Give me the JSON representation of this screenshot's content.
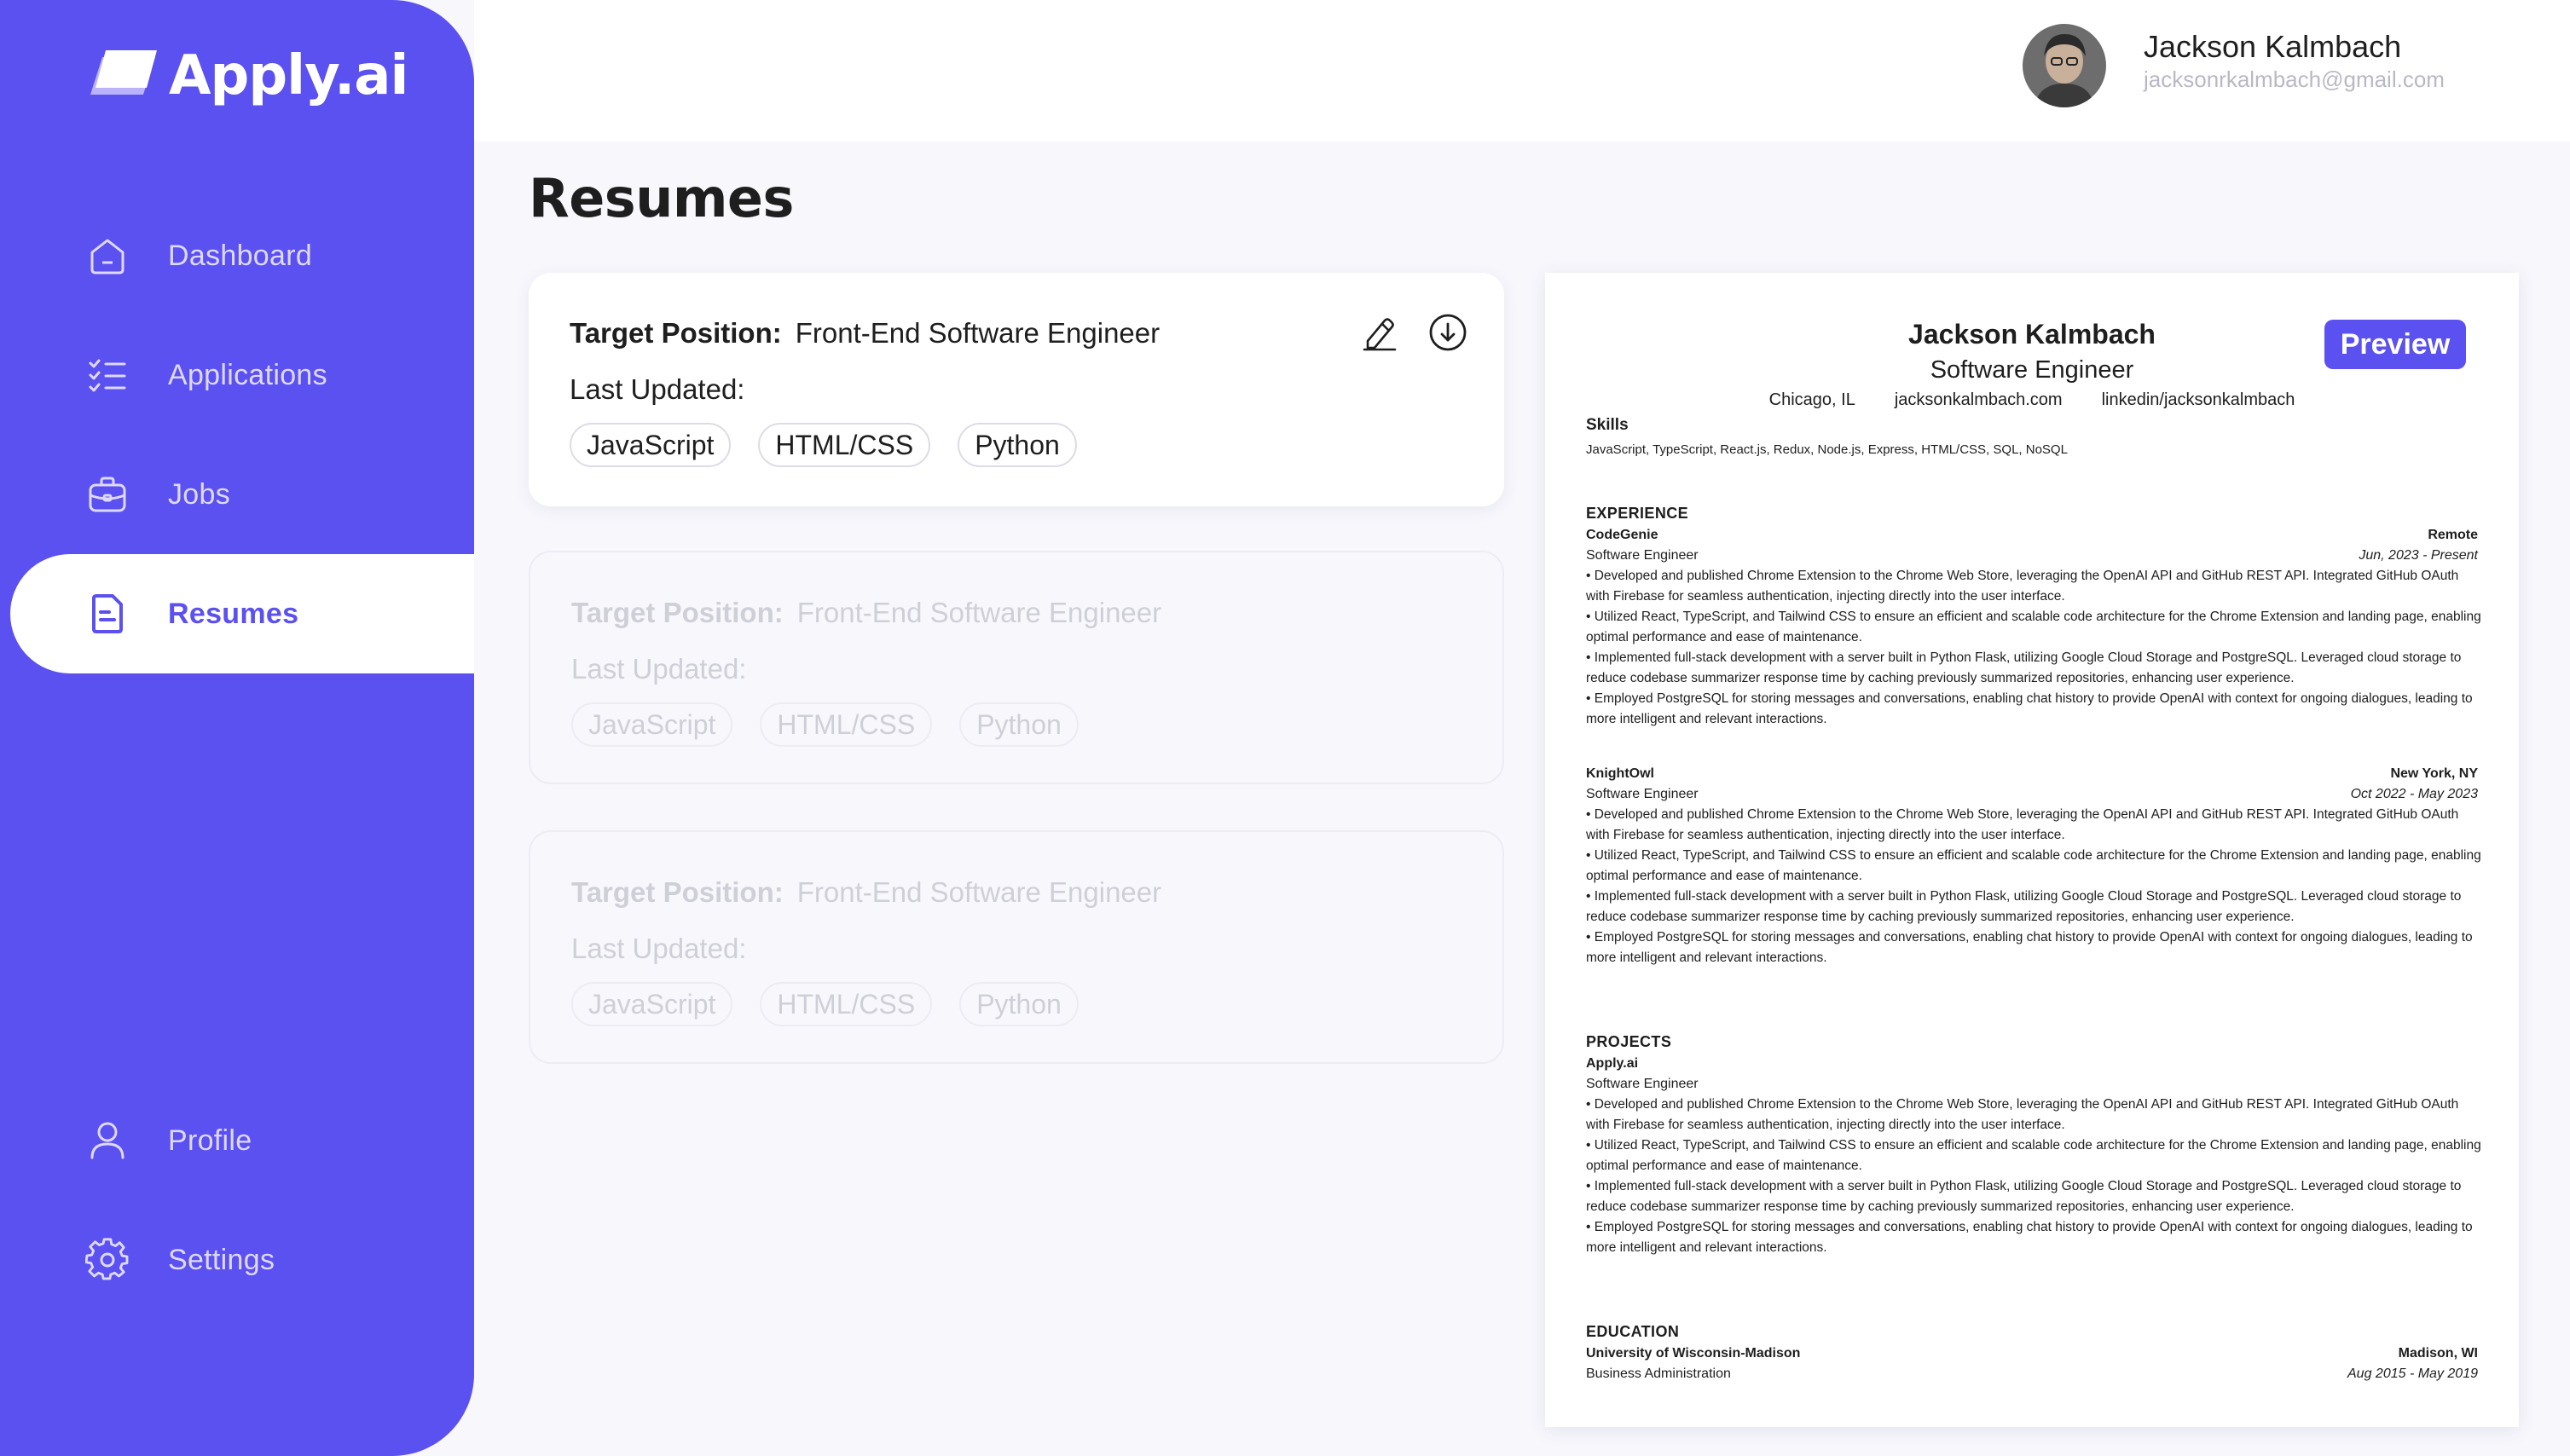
{
  "app": {
    "name": "Apply.ai"
  },
  "sidebar": {
    "items": [
      {
        "label": "Dashboard",
        "icon": "home-icon"
      },
      {
        "label": "Applications",
        "icon": "checklist-icon"
      },
      {
        "label": "Jobs",
        "icon": "briefcase-icon"
      },
      {
        "label": "Resumes",
        "icon": "document-icon",
        "active": true
      },
      {
        "label": "Profile",
        "icon": "user-icon"
      },
      {
        "label": "Settings",
        "icon": "gear-icon"
      }
    ]
  },
  "header": {
    "user_name": "Jackson Kalmbach",
    "user_email": "jacksonrkalmbach@gmail.com"
  },
  "main": {
    "title": "Resumes",
    "cards": [
      {
        "target_label": "Target Position:",
        "target_value": "Front-End Software Engineer",
        "updated_label": "Last Updated:",
        "tags": [
          "JavaScript",
          "HTML/CSS",
          "Python"
        ]
      },
      {
        "target_label": "Target Position:",
        "target_value": "Front-End Software Engineer",
        "updated_label": "Last Updated:",
        "tags": [
          "JavaScript",
          "HTML/CSS",
          "Python"
        ]
      },
      {
        "target_label": "Target Position:",
        "target_value": "Front-End Software Engineer",
        "updated_label": "Last Updated:",
        "tags": [
          "JavaScript",
          "HTML/CSS",
          "Python"
        ]
      }
    ]
  },
  "preview": {
    "button_label": "Preview",
    "name": "Jackson Kalmbach",
    "role": "Software Engineer",
    "contacts": [
      "Chicago, IL",
      "jacksonkalmbach.com",
      "linkedin/jacksonkalmbach"
    ],
    "skills_title": "Skills",
    "skills": "JavaScript, TypeScript, React.js, Redux, Node.js, Express, HTML/CSS, SQL, NoSQL",
    "experience_title": "EXPERIENCE",
    "experience": [
      {
        "company": "CodeGenie",
        "location": "Remote",
        "title": "Software Engineer",
        "dates": "Jun, 2023 - Present",
        "bullets": [
          "• Developed and published Chrome Extension to the Chrome Web Store, leveraging the OpenAI API and GitHub REST API. Integrated GitHub OAuth with Firebase for seamless authentication, injecting directly into the user interface.",
          "• Utilized React, TypeScript, and Tailwind CSS to ensure an efficient and scalable code architecture for the Chrome Extension and landing page, enabling optimal performance and ease of maintenance.",
          "• Implemented full-stack development with a server built in Python Flask, utilizing Google Cloud Storage and PostgreSQL. Leveraged cloud storage to reduce codebase summarizer response time by caching previously summarized repositories, enhancing user experience.",
          "• Employed PostgreSQL for storing messages and conversations, enabling chat history to provide OpenAI with context for ongoing dialogues, leading to more intelligent and relevant interactions."
        ]
      },
      {
        "company": "KnightOwl",
        "location": "New York, NY",
        "title": "Software Engineer",
        "dates": "Oct 2022 - May 2023",
        "bullets": [
          "• Developed and published Chrome Extension to the Chrome Web Store, leveraging the OpenAI API and GitHub REST API. Integrated GitHub OAuth with Firebase for seamless authentication, injecting directly into the user interface.",
          "• Utilized React, TypeScript, and Tailwind CSS to ensure an efficient and scalable code architecture for the Chrome Extension and landing page, enabling optimal performance and ease of maintenance.",
          "• Implemented full-stack development with a server built in Python Flask, utilizing Google Cloud Storage and PostgreSQL. Leveraged cloud storage to reduce codebase summarizer response time by caching previously summarized repositories, enhancing user experience.",
          "• Employed PostgreSQL for storing messages and conversations, enabling chat history to provide OpenAI with context for ongoing dialogues, leading to more intelligent and relevant interactions."
        ]
      }
    ],
    "projects_title": "PROJECTS",
    "project": {
      "name": "Apply.ai",
      "title": "Software Engineer",
      "bullets": [
        "• Developed and published Chrome Extension to the Chrome Web Store, leveraging the OpenAI API and GitHub REST API. Integrated GitHub OAuth with Firebase for seamless authentication, injecting directly into the user interface.",
        "• Utilized React, TypeScript, and Tailwind CSS to ensure an efficient and scalable code architecture for the Chrome Extension and landing page, enabling optimal performance and ease of maintenance.",
        "• Implemented full-stack development with a server built in Python Flask, utilizing Google Cloud Storage and PostgreSQL. Leveraged cloud storage to reduce codebase summarizer response time by caching previously summarized repositories, enhancing user experience.",
        "• Employed PostgreSQL for storing messages and conversations, enabling chat history to provide OpenAI with context for ongoing dialogues, leading to more intelligent and relevant interactions."
      ]
    },
    "education_title": "EDUCATION",
    "education": {
      "school": "University of Wisconsin-Madison",
      "location": "Madison, WI",
      "degree": "Business Administration",
      "dates": "Aug 2015 - May 2019"
    }
  },
  "colors": {
    "brand": "#5b50f0",
    "background": "#f7f7fc",
    "nav_text": "#ded9ff"
  }
}
